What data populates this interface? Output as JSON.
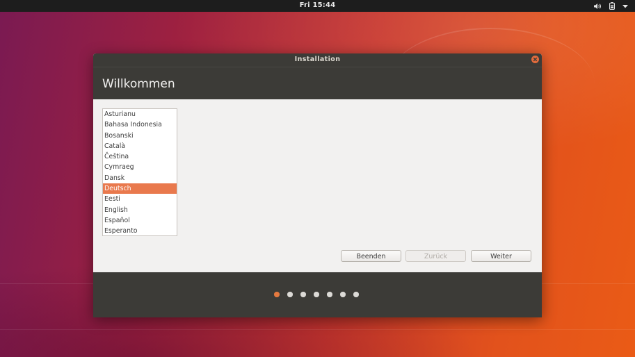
{
  "topbar": {
    "clock": "Fri 15:44",
    "icons": [
      "speaker-icon",
      "battery-icon",
      "menu-arrow-icon"
    ]
  },
  "window": {
    "title": "Installation",
    "header_title": "Willkommen",
    "languages": [
      {
        "label": "Asturianu",
        "selected": false
      },
      {
        "label": "Bahasa Indonesia",
        "selected": false
      },
      {
        "label": "Bosanski",
        "selected": false
      },
      {
        "label": "Català",
        "selected": false
      },
      {
        "label": "Čeština",
        "selected": false
      },
      {
        "label": "Cymraeg",
        "selected": false
      },
      {
        "label": "Dansk",
        "selected": false
      },
      {
        "label": "Deutsch",
        "selected": true
      },
      {
        "label": "Eesti",
        "selected": false
      },
      {
        "label": "English",
        "selected": false
      },
      {
        "label": "Español",
        "selected": false
      },
      {
        "label": "Esperanto",
        "selected": false
      }
    ],
    "buttons": {
      "quit": "Beenden",
      "back": "Zurück",
      "next": "Weiter"
    },
    "progress": {
      "steps": 7,
      "current": 1
    }
  },
  "colors": {
    "accent": "#e9794d",
    "titlebar": "#3c3b37",
    "panel": "#1d1d1d"
  }
}
